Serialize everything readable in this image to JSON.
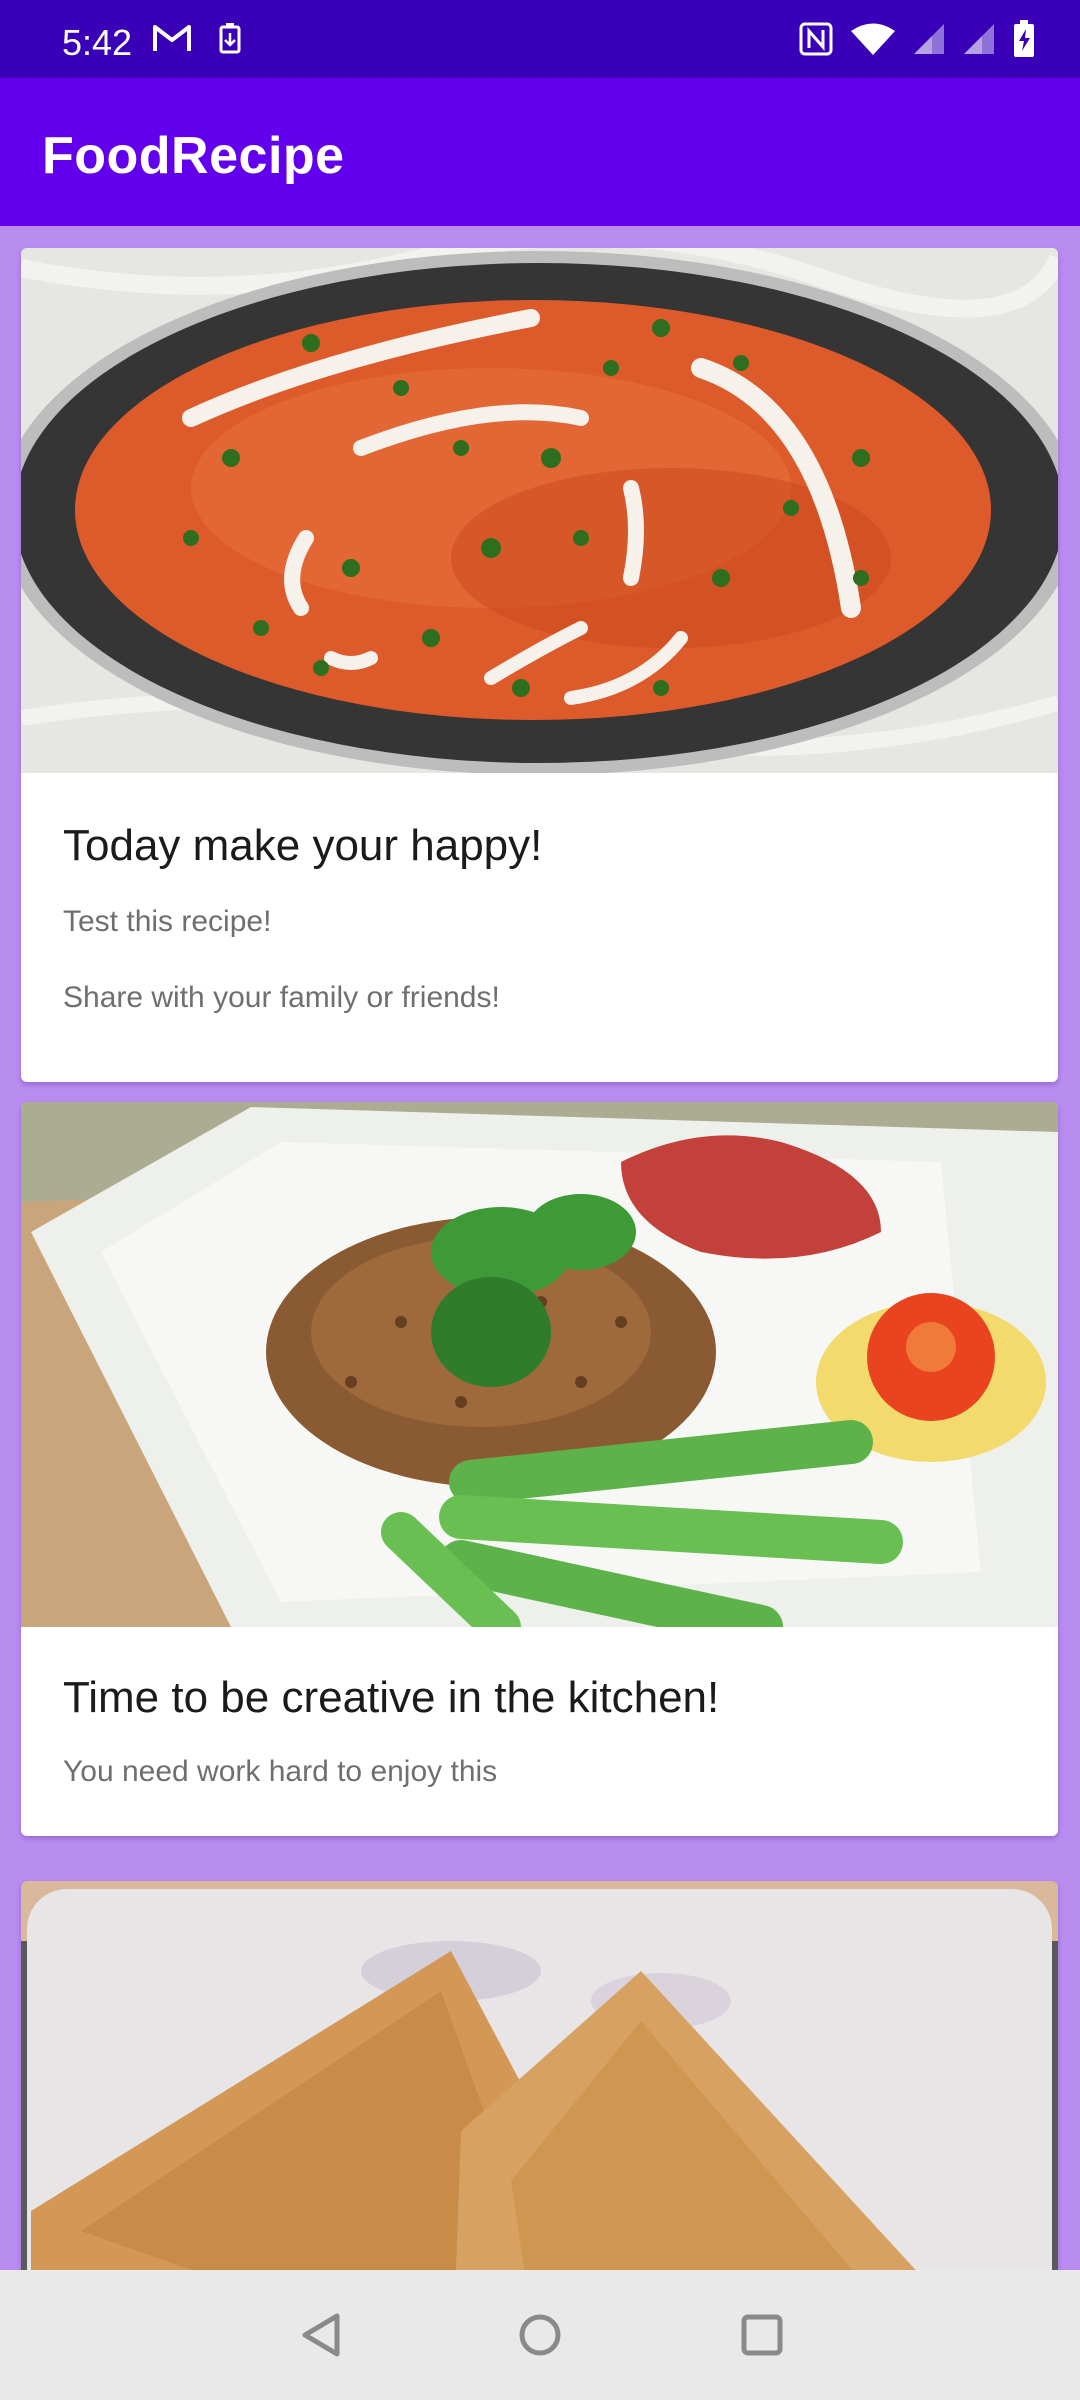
{
  "status_bar": {
    "time": "5:42",
    "left_icons": [
      "gmail-icon",
      "battery-saver-icon"
    ],
    "right_icons": [
      "nfc-icon",
      "wifi-icon",
      "signal-icon",
      "signal-icon",
      "battery-charging-icon"
    ]
  },
  "app_bar": {
    "title": "FoodRecipe"
  },
  "cards": [
    {
      "image": "food-photo-curry",
      "title": "Today make your happy!",
      "line1": "Test this recipe!",
      "line2": "Share with your family or friends!"
    },
    {
      "image": "food-photo-rice",
      "title": "Time to be creative in the kitchen!",
      "line1": "You need work hard to enjoy this"
    },
    {
      "image": "food-photo-samosa"
    }
  ],
  "nav_bar": {
    "buttons": [
      "back-icon",
      "home-icon",
      "recents-icon"
    ]
  },
  "colors": {
    "status_bar": "#3a00b8",
    "app_bar": "#6200ee",
    "background": "#b98df0",
    "nav_bar": "#e9e9e9"
  }
}
